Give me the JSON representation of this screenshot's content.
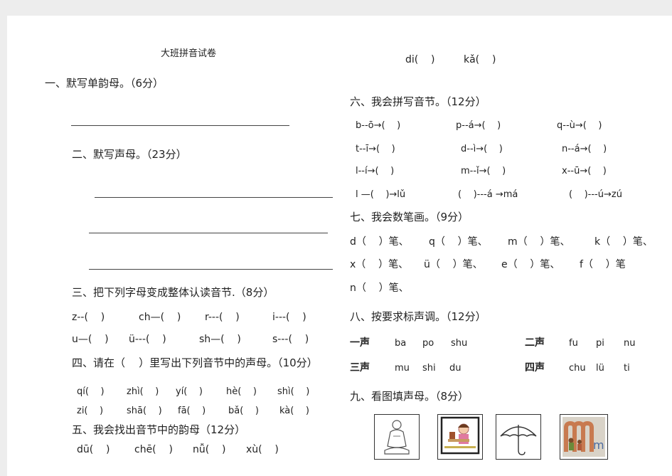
{
  "title": "大班拼音试卷",
  "s1": {
    "heading": "一、默写单韵母。（6分）"
  },
  "s2": {
    "heading": "二、默写声母。（23分）"
  },
  "s3": {
    "heading": "三、把下列字母变成整体认读音节.（8分）",
    "row1": [
      "z--(    )",
      "ch—(    )",
      "r---(    )",
      "i---(    )"
    ],
    "row2": [
      "u—(    )",
      "ü---(    )",
      "sh—(    )",
      "s---(    )"
    ]
  },
  "s4": {
    "heading": "四、请在（    ）里写出下列音节中的声母。（10分）",
    "row1": [
      "qí(    )",
      "zhì(    )",
      "yí(    )",
      "hè(    )",
      "shì(    )"
    ],
    "row2": [
      "zi(    )",
      "shā(    )",
      "fā(    )",
      "bǎ(    )",
      "kà(    )"
    ]
  },
  "s5": {
    "heading": "五、我会找出音节中的韵母（12分）",
    "row1": [
      "dū(    )",
      "chē(    )",
      "nǚ(    )",
      "xù(    )"
    ]
  },
  "top_right": [
    "di(    )",
    "kǎ(    )"
  ],
  "s6": {
    "heading": "六、我会拼写音节。（12分）",
    "rows": [
      [
        "b--ō→(    )",
        "p--á→(    )",
        "q--ù→(    )"
      ],
      [
        "t--ī→(    )",
        "d--ì→(    )",
        "n--á→(    )"
      ],
      [
        "l--í→(    )",
        "m--ǐ→(    )",
        "x--ū→(    )"
      ],
      [
        "l —(    )→lǔ",
        "(    )---á →má",
        "(    )---ú→zú"
      ]
    ]
  },
  "s7": {
    "heading": "七、我会数笔画。（9分）",
    "rows": [
      [
        "d（    ）笔、",
        "q（    ）笔、",
        "m（    ）笔、",
        "k（    ）笔、"
      ],
      [
        "x（    ）笔、",
        "ü（    ）笔、",
        "e（    ）笔、",
        "f（    ）笔"
      ],
      [
        "n（    ）笔、"
      ]
    ]
  },
  "s8": {
    "heading": "八、按要求标声调。（12分）",
    "row1_label": "一声",
    "row1": [
      "ba",
      "po",
      "shu"
    ],
    "row2_label": "二声",
    "row2": [
      "fu",
      "pi",
      "nu"
    ],
    "row3_label": "三声",
    "row3": [
      "mu",
      "shi",
      "du"
    ],
    "row4_label": "四声",
    "row4": [
      "chu",
      "lü",
      "ti"
    ]
  },
  "s9": {
    "heading": "九、看图填声母。（8分）",
    "pictures": [
      "buddha-statue",
      "girl-reading",
      "umbrella",
      "letter-m-card"
    ],
    "letter_card_text": "m"
  }
}
